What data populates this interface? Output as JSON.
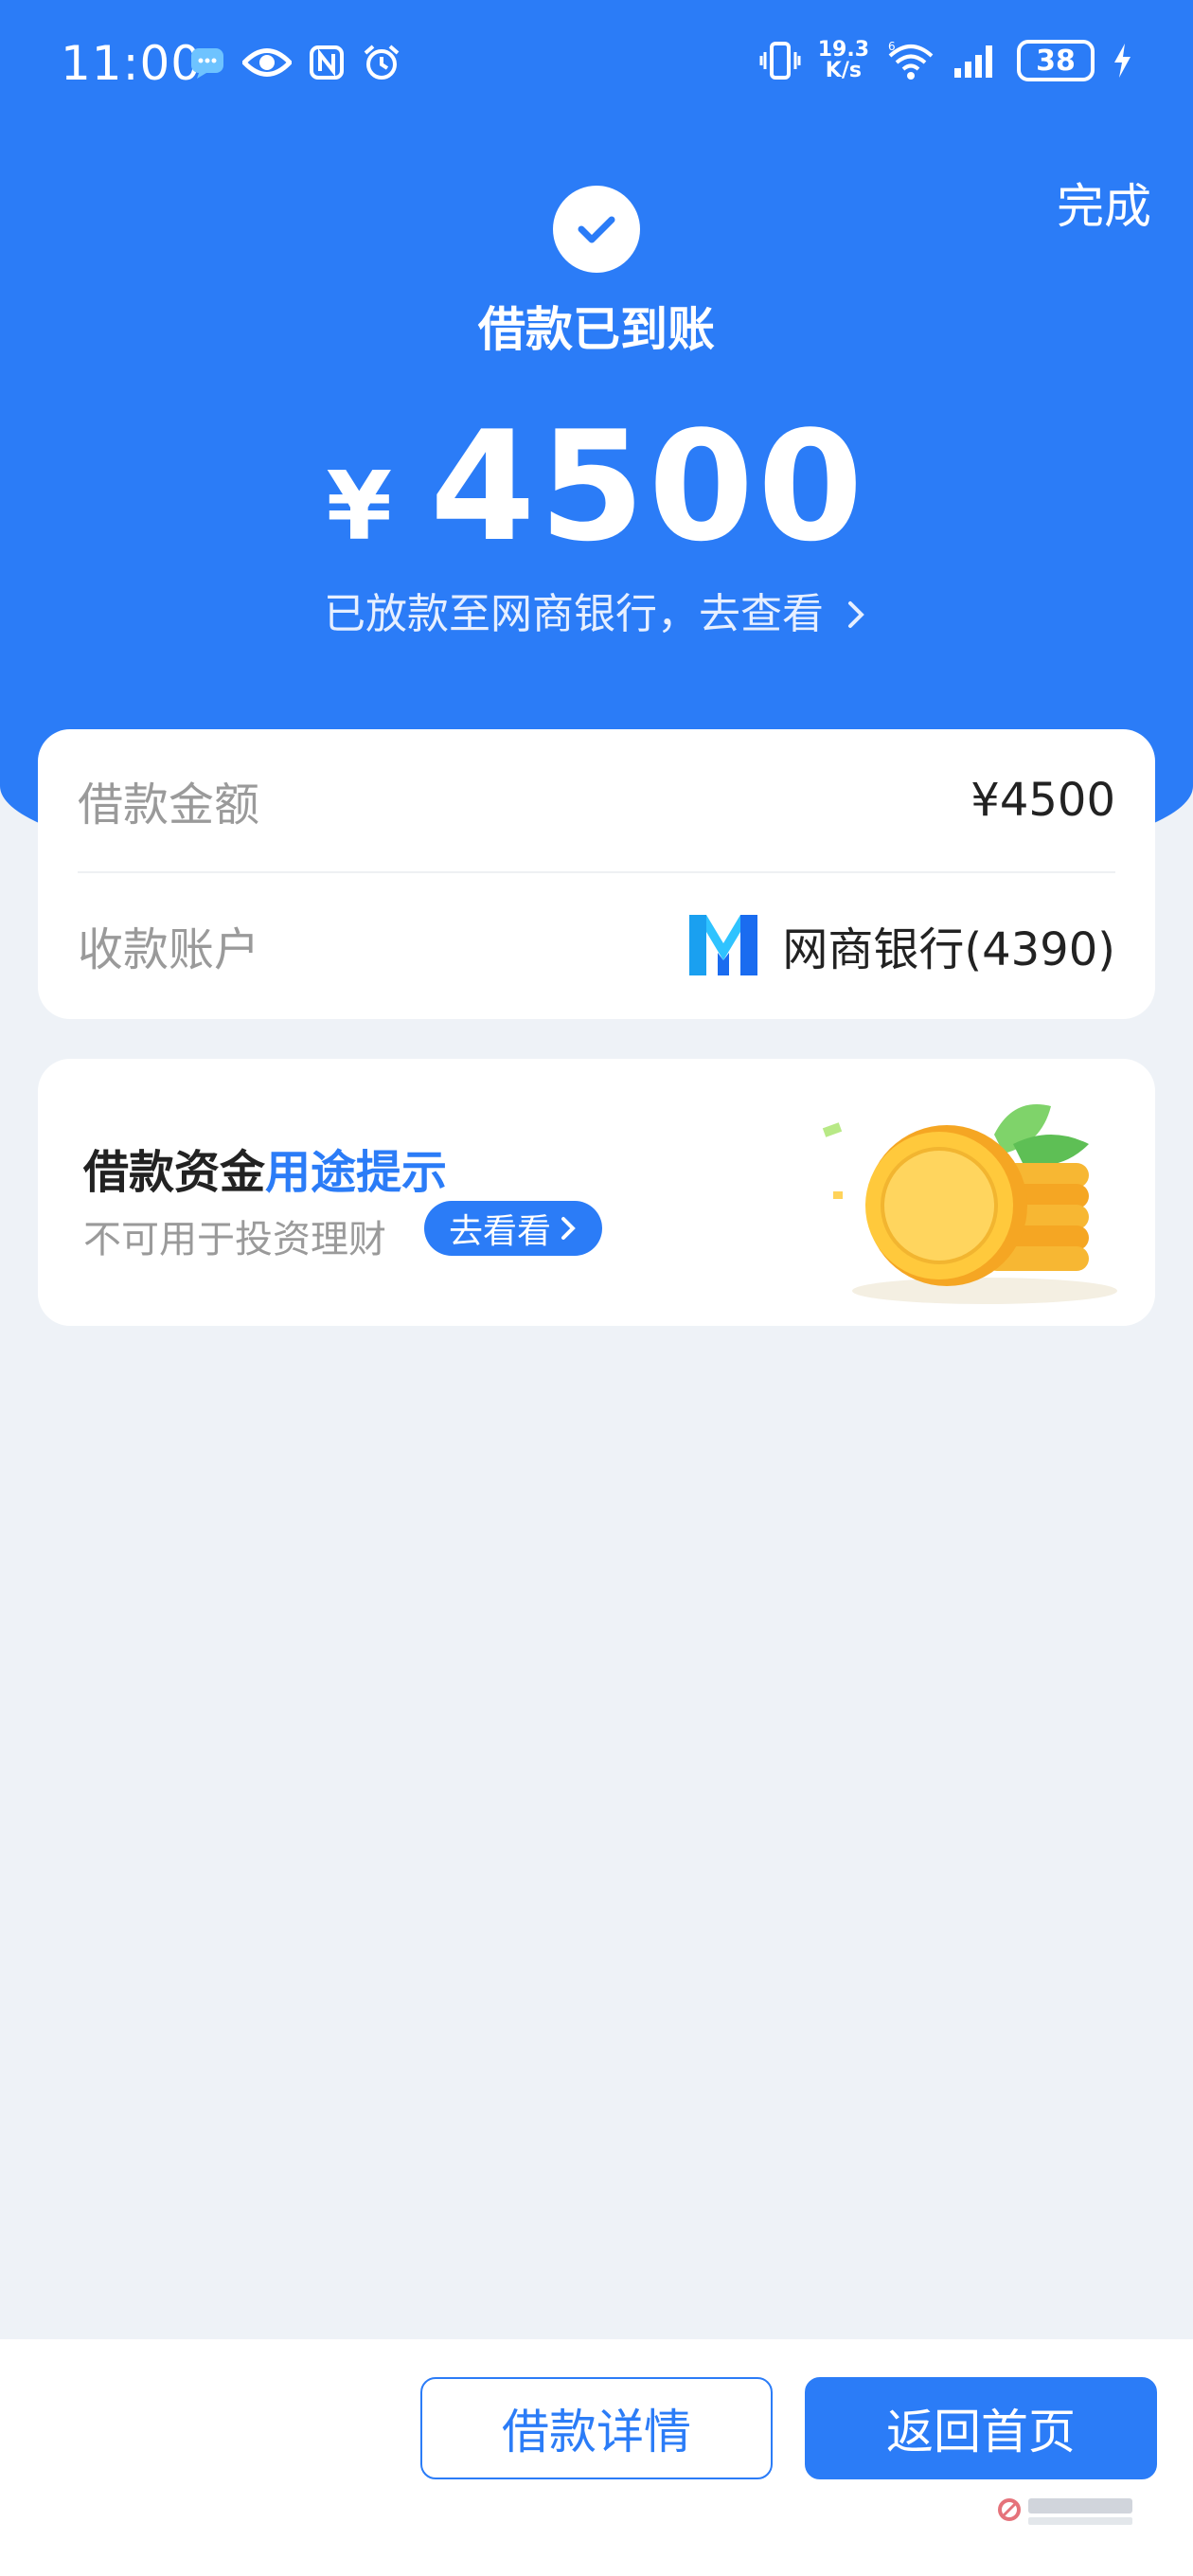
{
  "status_bar": {
    "time": "11:00",
    "net_speed_value": "19.3",
    "net_speed_unit": "K/s",
    "battery_level": "38",
    "icons_left": [
      "message-icon",
      "eye-icon",
      "nfc-icon",
      "alarm-icon"
    ],
    "icons_right": [
      "vibrate-icon",
      "wifi-6-icon",
      "signal-icon",
      "battery-icon",
      "charging-icon"
    ]
  },
  "header": {
    "done_label": "完成",
    "title": "借款已到账",
    "currency_symbol": "¥",
    "amount": "4500",
    "subtitle": "已放款至网商银行，去查看",
    "brand_color": "#2b7cf7"
  },
  "info_card": {
    "rows": [
      {
        "label": "借款金额",
        "value": "¥4500"
      },
      {
        "label": "收款账户",
        "value": "网商银行(4390)"
      }
    ]
  },
  "tip_card": {
    "title_main": "借款资金",
    "title_highlight": "用途提示",
    "description": "不可用于投资理财",
    "button_label": "去看看"
  },
  "bottom_bar": {
    "detail_button_label": "借款详情",
    "home_button_label": "返回首页"
  }
}
